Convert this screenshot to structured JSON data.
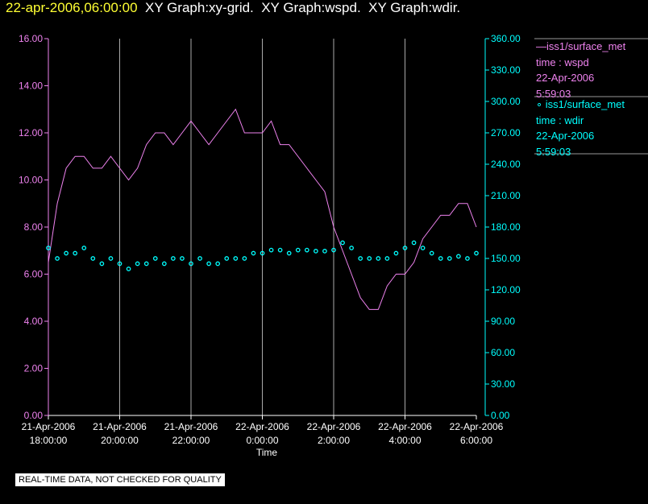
{
  "header": {
    "timestamp": "22-apr-2006,06:00:00",
    "graphs": "  XY Graph:xy-grid.  XY Graph:wspd.  XY Graph:wdir."
  },
  "note": "REAL-TIME DATA, NOT CHECKED FOR QUALITY",
  "legend": [
    {
      "marker": "line",
      "label": "iss1/surface_met",
      "sub": "time : wspd",
      "date": "22-Apr-2006",
      "time": "5:59:03",
      "color": "#ee82ee"
    },
    {
      "marker": "circle",
      "label": "iss1/surface_met",
      "sub": "time : wdir",
      "date": "22-Apr-2006",
      "time": "5:59:03",
      "color": "#00ffff"
    }
  ],
  "chart_data": {
    "type": "line",
    "xlabel": "Time",
    "x_ticks": [
      [
        "21-Apr-2006",
        "18:00:00"
      ],
      [
        "21-Apr-2006",
        "20:00:00"
      ],
      [
        "21-Apr-2006",
        "22:00:00"
      ],
      [
        "22-Apr-2006",
        "0:00:00"
      ],
      [
        "22-Apr-2006",
        "2:00:00"
      ],
      [
        "22-Apr-2006",
        "4:00:00"
      ],
      [
        "22-Apr-2006",
        "6:00:00"
      ]
    ],
    "xlim_hours": [
      0,
      12
    ],
    "y_left": {
      "lim": [
        0,
        16
      ],
      "ticks": [
        "0.00",
        "2.00",
        "4.00",
        "6.00",
        "8.00",
        "10.00",
        "12.00",
        "14.00",
        "16.00"
      ],
      "color": "#ee82ee"
    },
    "y_right": {
      "lim": [
        0,
        360
      ],
      "ticks": [
        "0.00",
        "30.00",
        "60.00",
        "90.00",
        "120.00",
        "150.00",
        "180.00",
        "210.00",
        "240.00",
        "270.00",
        "300.00",
        "330.00",
        "360.00"
      ],
      "color": "#00ffff"
    },
    "grid": "vertical",
    "x_hours_step": 0.25,
    "series": [
      {
        "name": "wspd",
        "axis": "left",
        "style": "line",
        "values": [
          6.5,
          9,
          10.5,
          11,
          11,
          10.5,
          10.5,
          11,
          10.5,
          10,
          10.5,
          11.5,
          12,
          12,
          11.5,
          12,
          12.5,
          12,
          11.5,
          12,
          12.5,
          13,
          12,
          12,
          12,
          12.5,
          11.5,
          11.5,
          11,
          10.5,
          10,
          9.5,
          8,
          7,
          6,
          5,
          4.5,
          4.5,
          5.5,
          6,
          6,
          6.5,
          7.5,
          8,
          8.5,
          8.5,
          9,
          9,
          8
        ]
      },
      {
        "name": "wdir",
        "axis": "right",
        "style": "points",
        "values": [
          160,
          150,
          155,
          155,
          160,
          150,
          145,
          150,
          145,
          140,
          145,
          145,
          150,
          145,
          150,
          150,
          145,
          150,
          145,
          145,
          150,
          150,
          150,
          155,
          155,
          158,
          158,
          155,
          158,
          158,
          157,
          157,
          158,
          165,
          160,
          150,
          150,
          150,
          150,
          155,
          160,
          165,
          160,
          155,
          150,
          150,
          152,
          150,
          155
        ]
      }
    ]
  }
}
